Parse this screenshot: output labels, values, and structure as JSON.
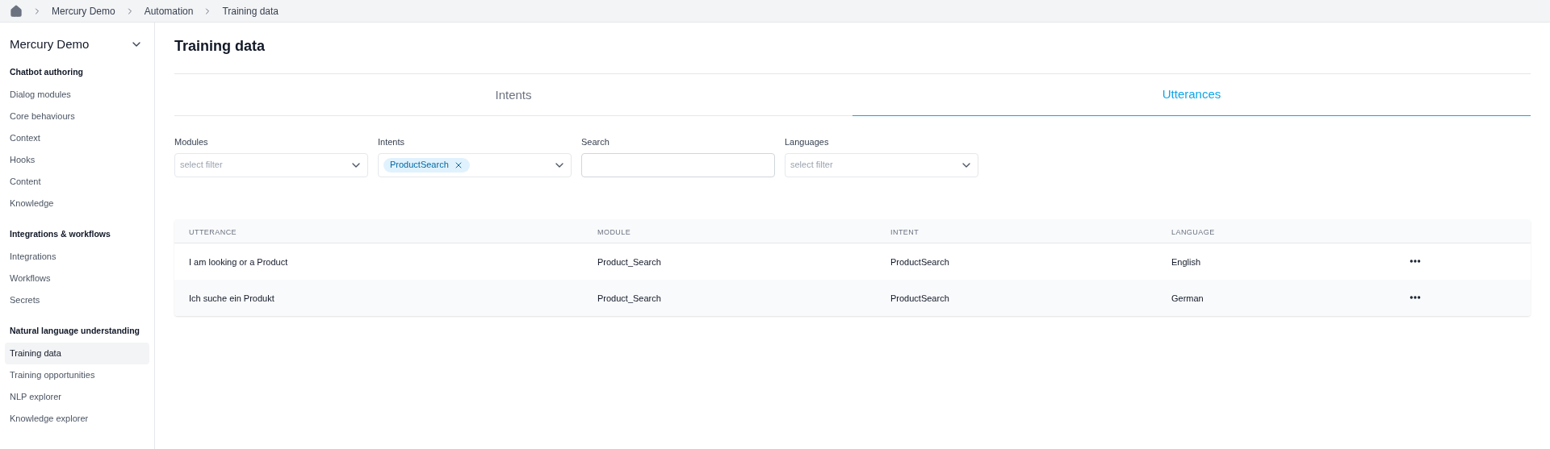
{
  "breadcrumb": [
    "Mercury Demo",
    "Automation",
    "Training data"
  ],
  "sidebar": {
    "title": "Mercury Demo",
    "sections": [
      {
        "heading": "Chatbot authoring",
        "items": [
          {
            "label": "Dialog modules",
            "selected": false
          },
          {
            "label": "Core behaviours",
            "selected": false
          },
          {
            "label": "Context",
            "selected": false
          },
          {
            "label": "Hooks",
            "selected": false
          },
          {
            "label": "Content",
            "selected": false
          },
          {
            "label": "Knowledge",
            "selected": false
          }
        ]
      },
      {
        "heading": "Integrations & workflows",
        "items": [
          {
            "label": "Integrations",
            "selected": false
          },
          {
            "label": "Workflows",
            "selected": false
          },
          {
            "label": "Secrets",
            "selected": false
          }
        ]
      },
      {
        "heading": "Natural language understanding",
        "items": [
          {
            "label": "Training data",
            "selected": true
          },
          {
            "label": "Training opportunities",
            "selected": false
          },
          {
            "label": "NLP explorer",
            "selected": false
          },
          {
            "label": "Knowledge explorer",
            "selected": false
          }
        ]
      }
    ]
  },
  "page_title": "Training data",
  "tabs": [
    {
      "label": "Intents",
      "selected": false
    },
    {
      "label": "Utterances",
      "selected": true
    }
  ],
  "filters": [
    {
      "kind": "select",
      "label": "Modules",
      "placeholder": "select filter"
    },
    {
      "kind": "select",
      "label": "Intents",
      "chips": [
        "ProductSearch"
      ]
    },
    {
      "kind": "text",
      "label": "Search"
    },
    {
      "kind": "select",
      "label": "Languages",
      "placeholder": "select filter"
    }
  ],
  "table": {
    "columns": [
      "UTTERANCE",
      "MODULE",
      "INTENT",
      "LANGUAGE"
    ],
    "rows": [
      [
        "I am looking or a Product",
        "Product_Search",
        "ProductSearch",
        "English"
      ],
      [
        "Ich suche ein Produkt",
        "Product_Search",
        "ProductSearch",
        "German"
      ]
    ]
  }
}
